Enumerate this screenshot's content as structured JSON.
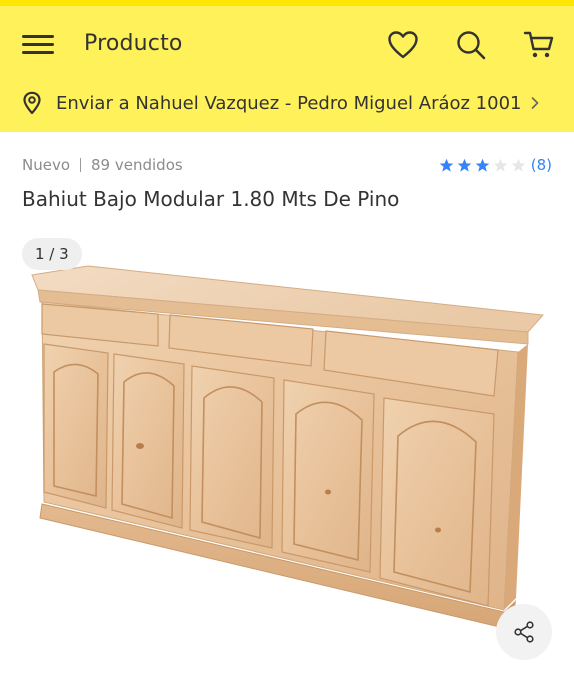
{
  "header": {
    "title": "Producto",
    "icons": {
      "menu": "menu-icon",
      "favorites": "heart-icon",
      "search": "search-icon",
      "cart": "cart-icon"
    },
    "brand_color": "#fff159"
  },
  "shipping": {
    "text": "Enviar a Nahuel Vazquez - Pedro Miguel Aráoz 1001",
    "icon": "location-pin-icon"
  },
  "product": {
    "condition": "Nuevo",
    "sold": "89 vendidos",
    "rating": 3,
    "rating_max": 5,
    "review_count": "(8)",
    "title": "Bahiut Bajo Modular 1.80 Mts De Pino",
    "star_color": "#3483fa"
  },
  "gallery": {
    "counter": "1 / 3",
    "image": "wooden-sideboard-image",
    "share_icon": "share-icon"
  }
}
